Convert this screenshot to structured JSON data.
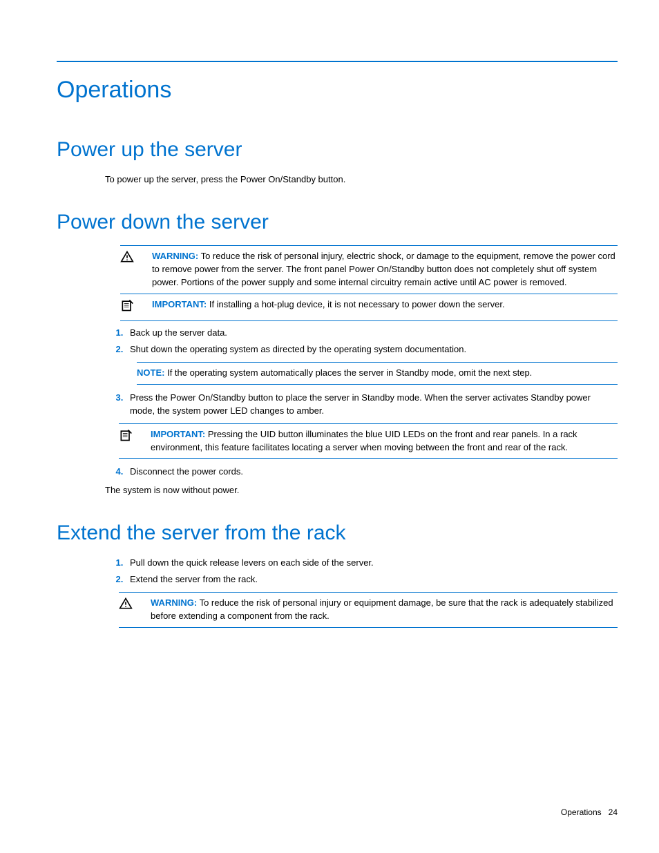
{
  "page_title": "Operations",
  "sections": {
    "power_up": {
      "heading": "Power up the server",
      "text": "To power up the server, press the Power On/Standby button."
    },
    "power_down": {
      "heading": "Power down the server",
      "warning_label": "WARNING:",
      "warning_text": "To reduce the risk of personal injury, electric shock, or damage to the equipment, remove the power cord to remove power from the server. The front panel Power On/Standby button does not completely shut off system power. Portions of the power supply and some internal circuitry remain active until AC power is removed.",
      "important_label": "IMPORTANT:",
      "important_text": "If installing a hot-plug device, it is not necessary to power down the server.",
      "step1": "Back up the server data.",
      "step2": "Shut down the operating system as directed by the operating system documentation.",
      "note_label": "NOTE:",
      "note_text": "If the operating system automatically places the server in Standby mode, omit the next step.",
      "step3": "Press the Power On/Standby button to place the server in Standby mode. When the server activates Standby power mode, the system power LED changes to amber.",
      "important2_label": "IMPORTANT:",
      "important2_text": "Pressing the UID button illuminates the blue UID LEDs on the front and rear panels. In a rack environment, this feature facilitates locating a server when moving between the front and rear of the rack.",
      "step4": "Disconnect the power cords.",
      "closing": "The system is now without power."
    },
    "extend": {
      "heading": "Extend the server from the rack",
      "step1": "Pull down the quick release levers on each side of the server.",
      "step2": "Extend the server from the rack.",
      "warning_label": "WARNING:",
      "warning_text": "To reduce the risk of personal injury or equipment damage, be sure that the rack is adequately stabilized before extending a component from the rack."
    }
  },
  "footer": {
    "section": "Operations",
    "page": "24"
  }
}
